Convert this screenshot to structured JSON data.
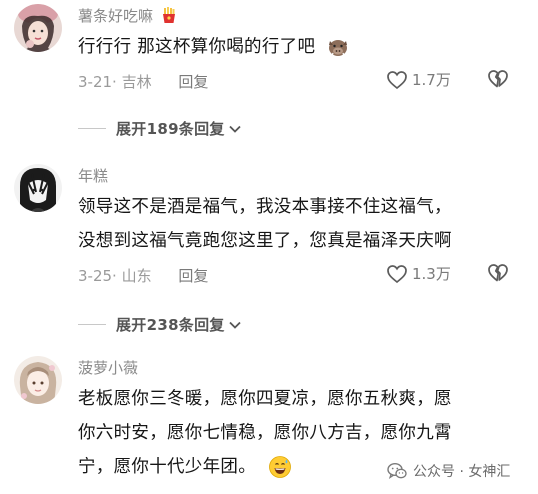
{
  "comments": [
    {
      "username": "薯条好吃嘛",
      "lines": [
        "行行行 那这杯算你喝的行了吧"
      ],
      "date": "3-21",
      "location": "吉林",
      "reply_label": "回复",
      "likes": "1.7万",
      "expand_label": "展开189条回复"
    },
    {
      "username": "年糕",
      "lines": [
        "领导这不是酒是福气，我没本事接不住这福气，",
        "没想到这福气竟跑您这里了，您真是福泽天庆啊"
      ],
      "date": "3-25",
      "location": "山东",
      "reply_label": "回复",
      "likes": "1.3万",
      "expand_label": "展开238条回复"
    },
    {
      "username": "菠萝小薇",
      "lines": [
        "老板愿你三冬暖，愿你四夏凉，愿你五秋爽，愿",
        "你六时安，愿你七情稳，愿你八方吉，愿你九霄",
        "宁，愿你十代少年团。"
      ]
    }
  ],
  "watermark": "公众号 · 女神汇",
  "icons": {
    "username_badge": "fries-icon",
    "emoji_1": "boar-icon",
    "emoji_3": "grinning-sweat-icon",
    "like": "heart-icon",
    "dislike": "broken-heart-icon",
    "expand": "chevron-down-icon",
    "watermark": "wechat-icon"
  }
}
